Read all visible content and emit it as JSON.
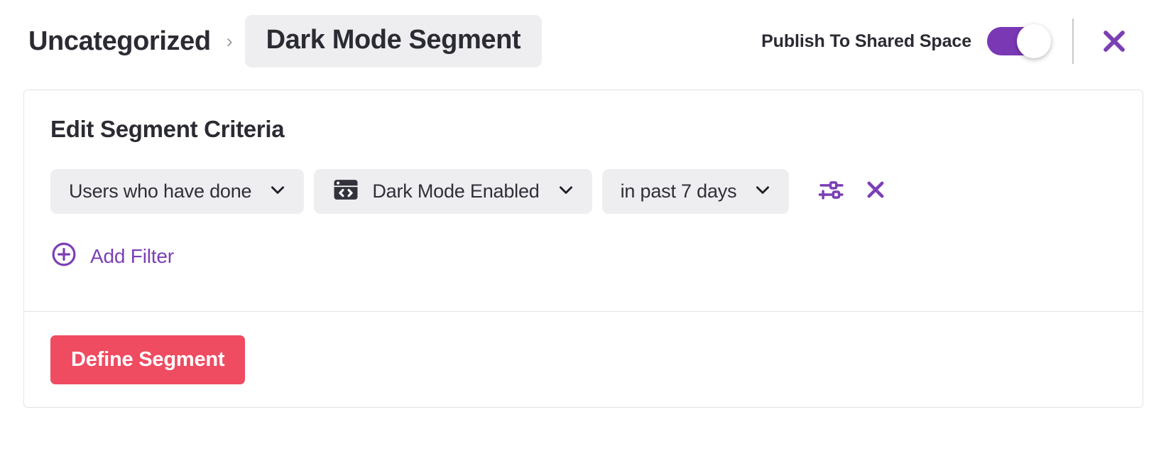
{
  "header": {
    "breadcrumb": {
      "root_label": "Uncategorized",
      "separator": "›",
      "current_label": "Dark Mode Segment"
    },
    "publish_label": "Publish To Shared Space",
    "publish_toggle_state": "on",
    "close_icon": "close-icon"
  },
  "card": {
    "title": "Edit Segment Criteria",
    "filter_row": {
      "scope_dropdown": {
        "value": "Users who have done",
        "chevron_icon": "chevron-down-icon"
      },
      "event_dropdown": {
        "value": "Dark Mode Enabled",
        "event_icon": "code-window-icon",
        "chevron_icon": "chevron-down-icon"
      },
      "timeframe_dropdown": {
        "value": "in past 7 days",
        "chevron_icon": "chevron-down-icon"
      },
      "properties_icon": "sliders-icon",
      "remove_icon": "close-icon"
    },
    "add_filter": {
      "label": "Add Filter",
      "icon": "plus-circle-icon"
    },
    "footer": {
      "primary_button_label": "Define Segment"
    }
  },
  "colors": {
    "accent_purple": "#7B3FB5",
    "toggle_on": "#7B38B5",
    "primary_button": "#EF4B61",
    "pill_background": "#EEEEF1",
    "text_dark": "#2B2B33",
    "border": "#E3E3E8"
  }
}
